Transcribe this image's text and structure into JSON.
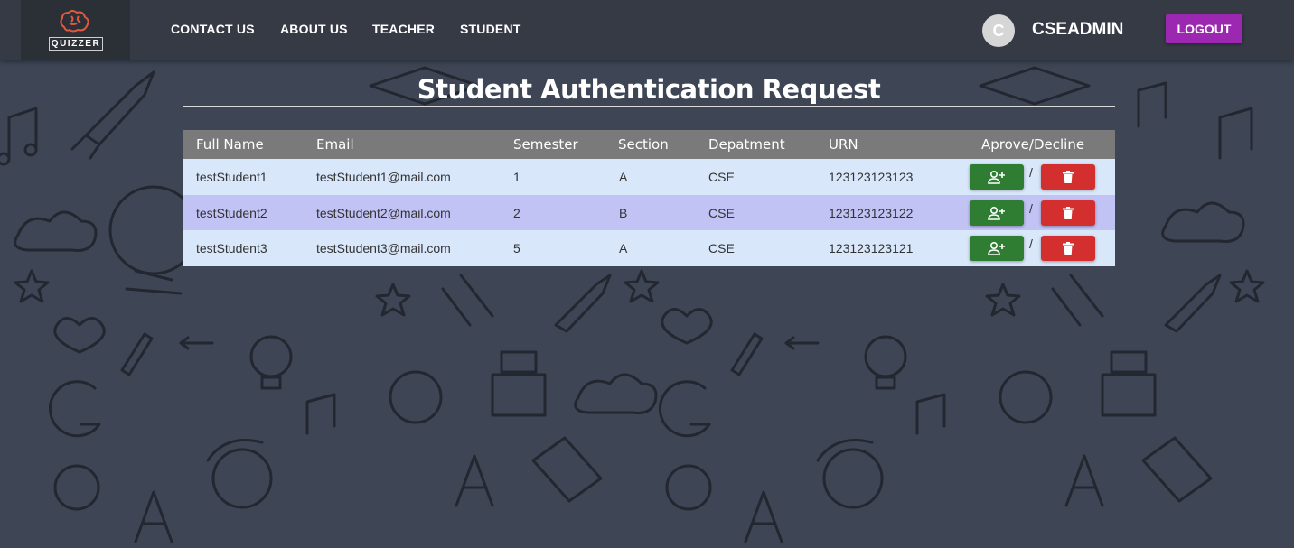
{
  "logo": {
    "text": "QUIZZER"
  },
  "nav": {
    "links": [
      "CONTACT US",
      "ABOUT US",
      "TEACHER",
      "STUDENT"
    ]
  },
  "user": {
    "avatar_initial": "C",
    "name": "CSEADMIN"
  },
  "logout_label": "LOGOUT",
  "page": {
    "title": "Student Authentication Request"
  },
  "table": {
    "headers": [
      "Full Name",
      "Email",
      "Semester",
      "Section",
      "Depatment",
      "URN",
      "Aprove/Decline"
    ],
    "rows": [
      {
        "name": "testStudent1",
        "email": "testStudent1@mail.com",
        "semester": "1",
        "section": "A",
        "department": "CSE",
        "urn": "123123123123"
      },
      {
        "name": "testStudent2",
        "email": "testStudent2@mail.com",
        "semester": "2",
        "section": "B",
        "department": "CSE",
        "urn": "123123123122"
      },
      {
        "name": "testStudent3",
        "email": "testStudent3@mail.com",
        "semester": "5",
        "section": "A",
        "department": "CSE",
        "urn": "123123123121"
      }
    ],
    "separator": "/",
    "row_colors": [
      "#d9e7fb",
      "#c2c3f5",
      "#d9e7fb"
    ],
    "approve_icon": "add-user-icon",
    "decline_icon": "trash-icon"
  },
  "colors": {
    "navbar": "#353a45",
    "logout": "#9c27b0",
    "approve": "#2e7d32",
    "decline": "#d32f2f",
    "background": "#3e4656"
  }
}
